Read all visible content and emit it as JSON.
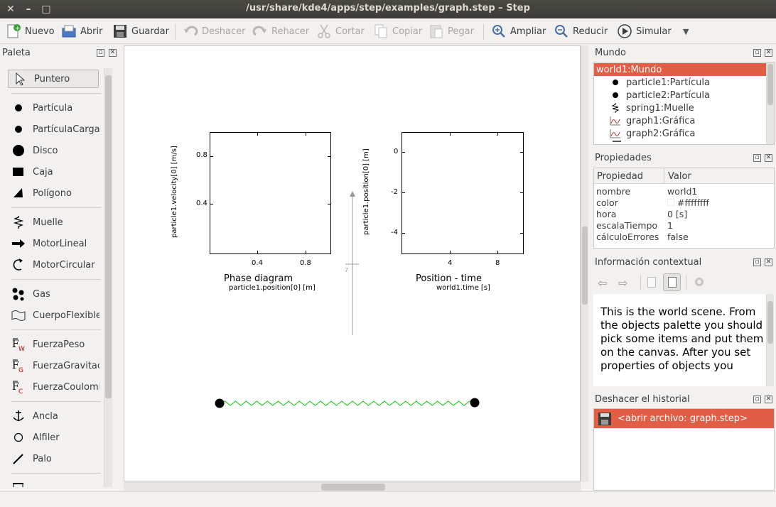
{
  "window": {
    "title": "/usr/share/kde4/apps/step/examples/graph.step – Step",
    "close": "✕",
    "minimize": "–",
    "maximize": "□"
  },
  "toolbar": {
    "new": "Nuevo",
    "open": "Abrir",
    "save": "Guardar",
    "undo": "Deshacer",
    "redo": "Rehacer",
    "cut": "Cortar",
    "copy": "Copiar",
    "paste": "Pegar",
    "zoom_in": "Ampliar",
    "zoom_out": "Reducir",
    "simulate": "Simular",
    "more": "▼"
  },
  "palette": {
    "title": "Paleta",
    "pointer": "Puntero",
    "items": [
      {
        "label": "Partícula",
        "icon": "particle-icon"
      },
      {
        "label": "PartículaCargada",
        "icon": "charged-particle-icon"
      },
      {
        "label": "Disco",
        "icon": "disk-icon"
      },
      {
        "label": "Caja",
        "icon": "box-icon"
      },
      {
        "label": "Polígono",
        "icon": "polygon-icon"
      },
      {
        "label": "Muelle",
        "icon": "spring-icon"
      },
      {
        "label": "MotorLineal",
        "icon": "linear-motor-icon"
      },
      {
        "label": "MotorCircular",
        "icon": "circular-motor-icon"
      },
      {
        "label": "Gas",
        "icon": "gas-icon"
      },
      {
        "label": "CuerpoFlexible",
        "icon": "soft-body-icon"
      },
      {
        "label": "FuerzaPeso",
        "icon": "weight-force-icon"
      },
      {
        "label": "FuerzaGravitacional",
        "icon": "gravitation-force-icon"
      },
      {
        "label": "FuerzaCoulomb",
        "icon": "coulomb-force-icon"
      },
      {
        "label": "Ancla",
        "icon": "anchor-icon"
      },
      {
        "label": "Alfiler",
        "icon": "pin-icon"
      },
      {
        "label": "Palo",
        "icon": "stick-icon"
      }
    ]
  },
  "canvas": {
    "graph1": {
      "title": "Phase diagram",
      "xlabel": "particle1.position[0] [m]",
      "ylabel": "particle1.velocity[0] [m/s]",
      "xticks": [
        "0.4",
        "0.8"
      ],
      "yticks": [
        "0.8",
        "0.4"
      ]
    },
    "graph2": {
      "title": "Position - time",
      "xlabel": "world1.time [s]",
      "ylabel": "particle1.position[0] [m]",
      "xticks": [
        "4",
        "8"
      ],
      "yticks": [
        "0",
        "-2",
        "-4"
      ]
    },
    "note_mark": "7"
  },
  "world_panel": {
    "title": "Mundo",
    "items": [
      {
        "label": "world1:Mundo",
        "icon": "world-icon",
        "selected": true
      },
      {
        "label": "particle1:Partícula",
        "icon": "particle-icon"
      },
      {
        "label": "particle2:Partícula",
        "icon": "particle-icon"
      },
      {
        "label": "spring1:Muelle",
        "icon": "spring-icon"
      },
      {
        "label": "graph1:Gráfica",
        "icon": "graph-icon"
      },
      {
        "label": "graph2:Gráfica",
        "icon": "graph-icon"
      }
    ]
  },
  "properties_panel": {
    "title": "Propiedades",
    "col_property": "Propiedad",
    "col_value": "Valor",
    "rows": [
      {
        "name": "nombre",
        "value": "world1"
      },
      {
        "name": "color",
        "value": "#ffffffff"
      },
      {
        "name": "hora",
        "value": "0 [s]"
      },
      {
        "name": "escalaTiempo",
        "value": "1"
      },
      {
        "name": "cálculoErrores",
        "value": "false"
      }
    ]
  },
  "info_panel": {
    "title": "Información contextual",
    "text": "This is the world scene. From the objects palette you should pick some items and put them on the canvas. After you set properties of objects you"
  },
  "undo_panel": {
    "title": "Deshacer el historial",
    "items": [
      {
        "label": "<abrir archivo: graph.step>",
        "selected": true
      }
    ]
  },
  "colors": {
    "selection": "#e25d46",
    "spring": "#00cc00",
    "titlebar": "#3c3b37"
  }
}
